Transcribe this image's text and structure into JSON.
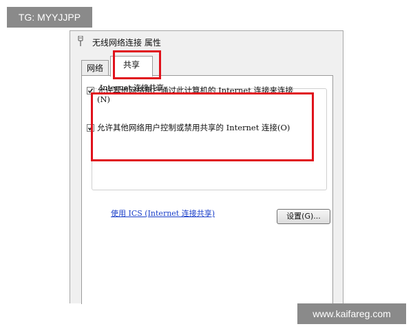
{
  "watermarks": {
    "top": "TG: MYYJJPP",
    "bottom": "www.kaifareg.com"
  },
  "dialog": {
    "title": "无线网络连接 属性",
    "tabs": [
      {
        "label": "网络"
      },
      {
        "label": "共享"
      }
    ],
    "group": {
      "label": "Internet 连接共享",
      "options": [
        {
          "text": "允许其他网络用户通过此计算机的 Internet 连接来连接(N)",
          "checked": true
        },
        {
          "text": "允许其他网络用户控制或禁用共享的 Internet 连接(O)",
          "checked": true
        }
      ]
    },
    "ics_link": "使用 ICS (Internet 连接共享)",
    "settings_button": "设置(G)..."
  },
  "colors": {
    "highlight": "#e0111b",
    "link": "#1a3fc9"
  },
  "icons": {
    "title": "network-adapter-icon",
    "check": "checkmark-icon"
  }
}
